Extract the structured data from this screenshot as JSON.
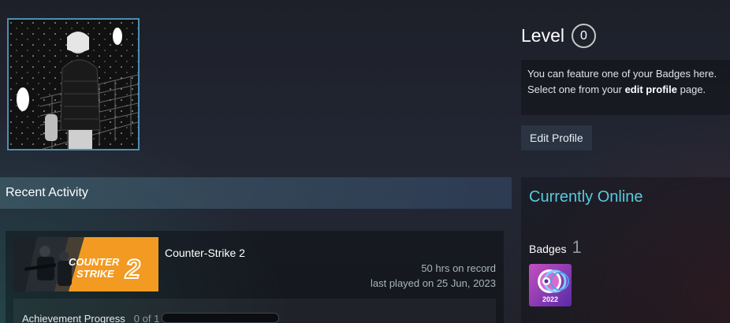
{
  "profile": {
    "level_label": "Level",
    "level_value": "0",
    "badge_notice": {
      "line1": "You can feature one of your Badges here.",
      "line2_prefix": "Select one from your ",
      "line2_link": "edit profile",
      "line2_suffix": " page."
    },
    "edit_profile_label": "Edit Profile"
  },
  "recent_activity": {
    "header": "Recent Activity",
    "games": [
      {
        "name": "Counter-Strike 2",
        "capsule_text_line1": "COUNTER",
        "capsule_text_line2": "STRIKE",
        "capsule_number": "2",
        "hours": "50 hrs on record",
        "last_played": "last played on 25 Jun, 2023",
        "achievement_label": "Achievement Progress",
        "achievement_count": "0 of 1",
        "achievement_fraction": 0
      }
    ]
  },
  "online": {
    "status": "Currently Online",
    "badges_label": "Badges",
    "badges_count": "1",
    "badge_year": "2022"
  },
  "colors": {
    "status_online": "#57cbde",
    "avatar_border": "#4d8fb1",
    "capsule_orange": "#f29a21"
  }
}
